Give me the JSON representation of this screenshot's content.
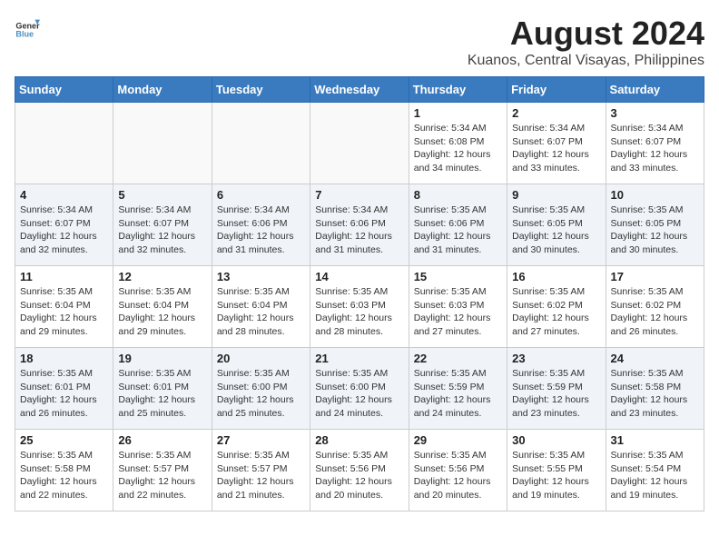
{
  "header": {
    "logo_general": "General",
    "logo_blue": "Blue",
    "title": "August 2024",
    "subtitle": "Kuanos, Central Visayas, Philippines"
  },
  "days_of_week": [
    "Sunday",
    "Monday",
    "Tuesday",
    "Wednesday",
    "Thursday",
    "Friday",
    "Saturday"
  ],
  "weeks": [
    [
      {
        "day": "",
        "info": ""
      },
      {
        "day": "",
        "info": ""
      },
      {
        "day": "",
        "info": ""
      },
      {
        "day": "",
        "info": ""
      },
      {
        "day": "1",
        "info": "Sunrise: 5:34 AM\nSunset: 6:08 PM\nDaylight: 12 hours\nand 34 minutes."
      },
      {
        "day": "2",
        "info": "Sunrise: 5:34 AM\nSunset: 6:07 PM\nDaylight: 12 hours\nand 33 minutes."
      },
      {
        "day": "3",
        "info": "Sunrise: 5:34 AM\nSunset: 6:07 PM\nDaylight: 12 hours\nand 33 minutes."
      }
    ],
    [
      {
        "day": "4",
        "info": "Sunrise: 5:34 AM\nSunset: 6:07 PM\nDaylight: 12 hours\nand 32 minutes."
      },
      {
        "day": "5",
        "info": "Sunrise: 5:34 AM\nSunset: 6:07 PM\nDaylight: 12 hours\nand 32 minutes."
      },
      {
        "day": "6",
        "info": "Sunrise: 5:34 AM\nSunset: 6:06 PM\nDaylight: 12 hours\nand 31 minutes."
      },
      {
        "day": "7",
        "info": "Sunrise: 5:34 AM\nSunset: 6:06 PM\nDaylight: 12 hours\nand 31 minutes."
      },
      {
        "day": "8",
        "info": "Sunrise: 5:35 AM\nSunset: 6:06 PM\nDaylight: 12 hours\nand 31 minutes."
      },
      {
        "day": "9",
        "info": "Sunrise: 5:35 AM\nSunset: 6:05 PM\nDaylight: 12 hours\nand 30 minutes."
      },
      {
        "day": "10",
        "info": "Sunrise: 5:35 AM\nSunset: 6:05 PM\nDaylight: 12 hours\nand 30 minutes."
      }
    ],
    [
      {
        "day": "11",
        "info": "Sunrise: 5:35 AM\nSunset: 6:04 PM\nDaylight: 12 hours\nand 29 minutes."
      },
      {
        "day": "12",
        "info": "Sunrise: 5:35 AM\nSunset: 6:04 PM\nDaylight: 12 hours\nand 29 minutes."
      },
      {
        "day": "13",
        "info": "Sunrise: 5:35 AM\nSunset: 6:04 PM\nDaylight: 12 hours\nand 28 minutes."
      },
      {
        "day": "14",
        "info": "Sunrise: 5:35 AM\nSunset: 6:03 PM\nDaylight: 12 hours\nand 28 minutes."
      },
      {
        "day": "15",
        "info": "Sunrise: 5:35 AM\nSunset: 6:03 PM\nDaylight: 12 hours\nand 27 minutes."
      },
      {
        "day": "16",
        "info": "Sunrise: 5:35 AM\nSunset: 6:02 PM\nDaylight: 12 hours\nand 27 minutes."
      },
      {
        "day": "17",
        "info": "Sunrise: 5:35 AM\nSunset: 6:02 PM\nDaylight: 12 hours\nand 26 minutes."
      }
    ],
    [
      {
        "day": "18",
        "info": "Sunrise: 5:35 AM\nSunset: 6:01 PM\nDaylight: 12 hours\nand 26 minutes."
      },
      {
        "day": "19",
        "info": "Sunrise: 5:35 AM\nSunset: 6:01 PM\nDaylight: 12 hours\nand 25 minutes."
      },
      {
        "day": "20",
        "info": "Sunrise: 5:35 AM\nSunset: 6:00 PM\nDaylight: 12 hours\nand 25 minutes."
      },
      {
        "day": "21",
        "info": "Sunrise: 5:35 AM\nSunset: 6:00 PM\nDaylight: 12 hours\nand 24 minutes."
      },
      {
        "day": "22",
        "info": "Sunrise: 5:35 AM\nSunset: 5:59 PM\nDaylight: 12 hours\nand 24 minutes."
      },
      {
        "day": "23",
        "info": "Sunrise: 5:35 AM\nSunset: 5:59 PM\nDaylight: 12 hours\nand 23 minutes."
      },
      {
        "day": "24",
        "info": "Sunrise: 5:35 AM\nSunset: 5:58 PM\nDaylight: 12 hours\nand 23 minutes."
      }
    ],
    [
      {
        "day": "25",
        "info": "Sunrise: 5:35 AM\nSunset: 5:58 PM\nDaylight: 12 hours\nand 22 minutes."
      },
      {
        "day": "26",
        "info": "Sunrise: 5:35 AM\nSunset: 5:57 PM\nDaylight: 12 hours\nand 22 minutes."
      },
      {
        "day": "27",
        "info": "Sunrise: 5:35 AM\nSunset: 5:57 PM\nDaylight: 12 hours\nand 21 minutes."
      },
      {
        "day": "28",
        "info": "Sunrise: 5:35 AM\nSunset: 5:56 PM\nDaylight: 12 hours\nand 20 minutes."
      },
      {
        "day": "29",
        "info": "Sunrise: 5:35 AM\nSunset: 5:56 PM\nDaylight: 12 hours\nand 20 minutes."
      },
      {
        "day": "30",
        "info": "Sunrise: 5:35 AM\nSunset: 5:55 PM\nDaylight: 12 hours\nand 19 minutes."
      },
      {
        "day": "31",
        "info": "Sunrise: 5:35 AM\nSunset: 5:54 PM\nDaylight: 12 hours\nand 19 minutes."
      }
    ]
  ]
}
